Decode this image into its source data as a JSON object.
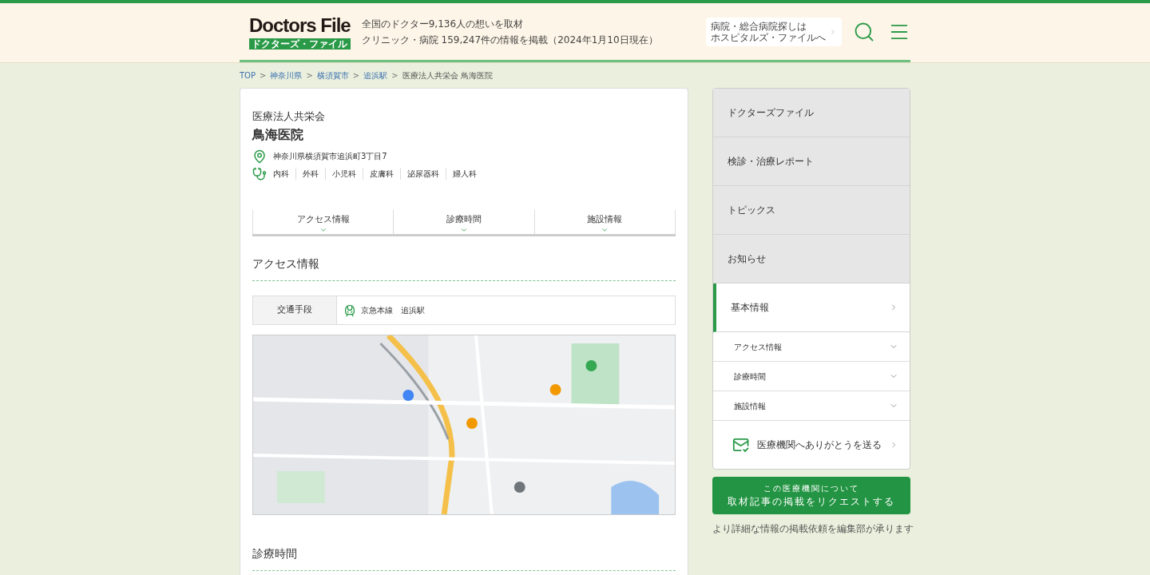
{
  "header": {
    "logo": "Doctors File",
    "logo_sub": "ドクターズ・ファイル",
    "tagline": [
      "全国のドクター9,136人の想いを取材",
      "クリニック・病院 159,247件の情報を掲載（2024年1月10日現在）"
    ],
    "hospital_link": [
      "病院・総合病院探しは",
      "ホスピタルズ・ファイルへ"
    ]
  },
  "breadcrumb": [
    {
      "label": "TOP",
      "link": true
    },
    {
      "sep": ">",
      "label": "神奈川県",
      "link": true
    },
    {
      "sep": ">",
      "label": "横須賀市",
      "link": true
    },
    {
      "sep": ">",
      "label": "追浜駅",
      "link": true
    },
    {
      "sep": ">",
      "label": "医療法人共栄会 鳥海医院",
      "link": false
    }
  ],
  "clinic": {
    "corporation": "医療法人共栄会",
    "name": "鳥海医院",
    "address": "神奈川県横須賀市追浜町3丁目7",
    "departments": [
      "内科",
      "外科",
      "小児科",
      "皮膚科",
      "泌尿器科",
      "婦人科"
    ]
  },
  "anchor_tabs": [
    "アクセス情報",
    "診療時間",
    "施設情報"
  ],
  "access": {
    "heading": "アクセス情報",
    "rows": [
      {
        "label": "交通手段",
        "value": "京急本線　追浜駅"
      }
    ]
  },
  "next_heading": "診療時間",
  "sidebar": {
    "items": [
      {
        "label": "ドクターズファイル",
        "selected": false
      },
      {
        "label": "検診・治療レポート",
        "selected": false
      },
      {
        "label": "トピックス",
        "selected": false
      },
      {
        "label": "お知らせ",
        "selected": false
      },
      {
        "label": "基本情報",
        "selected": true,
        "children": [
          {
            "label": "アクセス情報"
          },
          {
            "label": "診療時間"
          },
          {
            "label": "施設情報"
          }
        ]
      }
    ],
    "thanks": "医療機関へありがとうを送る",
    "request_button": {
      "sub": "この医療機関について",
      "main": "取材記事の掲載をリクエストする"
    },
    "note": "より詳細な情報の掲載依頼を編集部が承ります"
  }
}
